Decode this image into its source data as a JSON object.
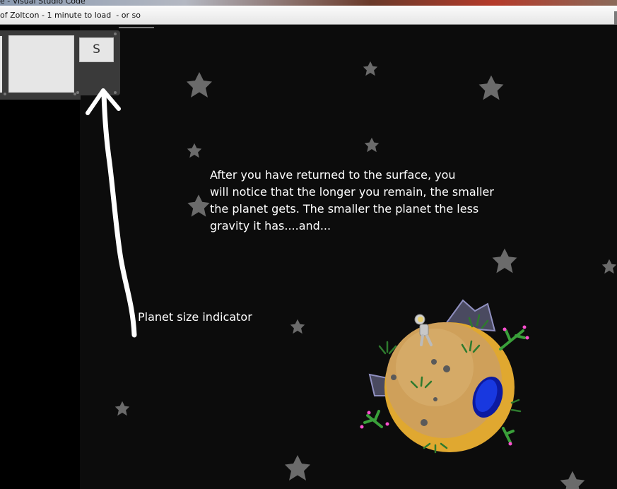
{
  "window": {
    "top_title": "e - Visual Studio Code",
    "tab_title": "of Zoltcon - 1 minute to load  - or so"
  },
  "hud": {
    "s_key_label": "S"
  },
  "tutorial": {
    "lines": [
      "After you have returned to the surface, you",
      "will notice that the longer you remain, the smaller",
      "the planet gets.  The smaller the planet the less",
      "gravity it has....and..."
    ],
    "indicator_label": "Planet size indicator"
  },
  "colors": {
    "background": "#0c0c0c",
    "star": "#6b6b6b",
    "text": "#ffffff",
    "planet": "#d4a85a",
    "planet_ring": "#e0a830",
    "portal": "#1030c0",
    "cactus": "#3aa03a"
  }
}
